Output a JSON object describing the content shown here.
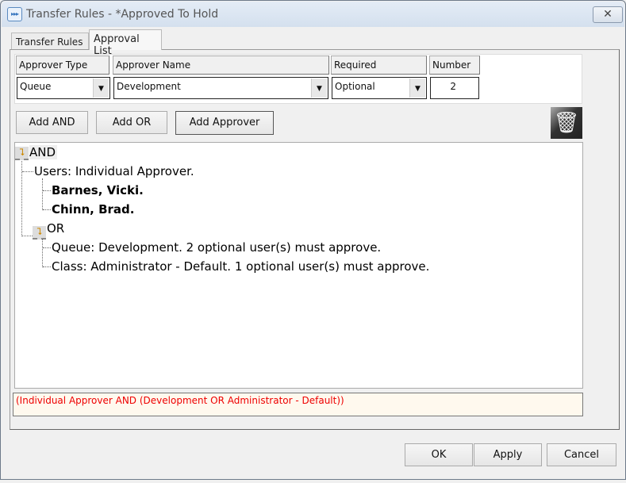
{
  "window": {
    "title": "Transfer Rules - *Approved To Hold",
    "close_icon": "close-icon"
  },
  "tabs": [
    {
      "label": "Transfer Rules"
    },
    {
      "label": "Approval List",
      "selected": true
    }
  ],
  "grid": {
    "headers": [
      "Approver Type",
      "Approver Name",
      "Required",
      "Number"
    ],
    "values": {
      "approver_type": "Queue",
      "approver_name": "Development",
      "required": "Optional",
      "number": "2"
    }
  },
  "buttons": {
    "add_and": "Add AND",
    "add_or": "Add OR",
    "add_approver": "Add Approver",
    "ok": "OK",
    "apply": "Apply",
    "cancel": "Cancel"
  },
  "tree": {
    "and": "AND",
    "users": "Users: Individual Approver.",
    "user1": "Barnes, Vicki.",
    "user2": "Chinn, Brad.",
    "or": "OR",
    "queue": "Queue: Development. 2 optional user(s) must approve.",
    "class": "Class: Administrator - Default. 1 optional user(s) must approve."
  },
  "expression": "(Individual Approver AND (Development OR Administrator - Default))",
  "colors": {
    "expression_text": "#ee0000",
    "expression_bg": "#fff9ee"
  }
}
